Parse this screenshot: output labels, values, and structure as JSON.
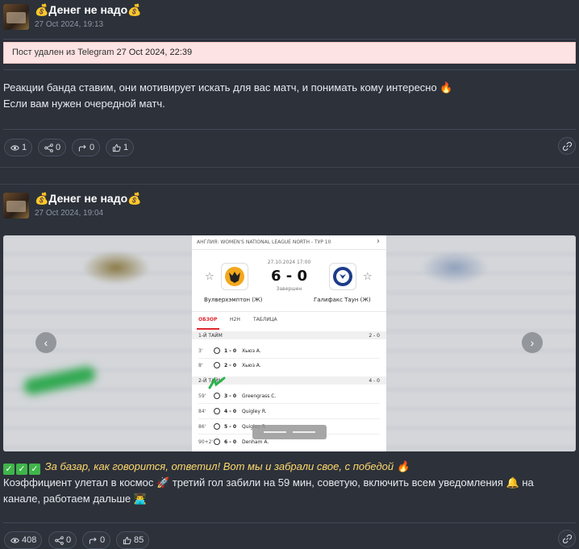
{
  "posts": [
    {
      "channel_name": "💰Денег не надо💰",
      "date": "27 Oct 2024, 19:13",
      "deleted_prefix": "Пост удален из Telegram ",
      "deleted_date": "27 Oct 2024, 22:39",
      "text_line1": "Реакции банда ставим, они мотивирует искать для вас матч, и понимать кому интересно 🔥",
      "text_line2": "Если вам нужен очередной матч.",
      "stats": {
        "views": "1",
        "shares": "0",
        "forwards": "0",
        "reactions": "1"
      }
    },
    {
      "channel_name": "💰Денег не надо💰",
      "date": "27 Oct 2024, 19:04",
      "text_line1_italic": "За базар, как говорится, ответил! Вот мы и забрали свое, с победой 🔥",
      "text_line2": "Коэффициент улетал в космос 🚀 третий гол забили на 59 мин, советую, включить всем уведомления 🔔 на",
      "text_line3": "канале, работаем дальше 👨‍💻",
      "stats": {
        "views": "408",
        "shares": "0",
        "forwards": "0",
        "reactions": "85"
      }
    }
  ],
  "match_card": {
    "league": "АНГЛИЯ: WOMEN'S NATIONAL LEAGUE NORTH - ТУР 10",
    "datetime": "27.10.2024 17:00",
    "score": "6 - 0",
    "status": "Завершен",
    "home_team": "Вулверхэмптон (Ж)",
    "away_team": "Галифакс Таун (Ж)",
    "tabs": [
      "ОБЗОР",
      "H2H",
      "ТАБЛИЦА"
    ],
    "first_half": {
      "label": "1-Й ТАЙМ",
      "score": "2 - 0"
    },
    "second_half": {
      "label": "2-Й ТАЙМ",
      "score": "4 - 0"
    },
    "goals": [
      {
        "minute": "3'",
        "score": "1 - 0",
        "player": "Хьюз А."
      },
      {
        "minute": "8'",
        "score": "2 - 0",
        "player": "Хьюз А."
      },
      {
        "minute": "59'",
        "score": "3 - 0",
        "player": "Greengrass C."
      },
      {
        "minute": "84'",
        "score": "4 - 0",
        "player": "Quigley R."
      },
      {
        "minute": "86'",
        "score": "5 - 0",
        "player": "Quigley R."
      },
      {
        "minute": "90+2'",
        "score": "6 - 0",
        "player": "Denham A."
      }
    ]
  },
  "icons": {
    "views": "eye-icon",
    "shares": "share-icon",
    "forwards": "forward-icon",
    "reactions": "thumbs-up-icon",
    "link": "link-icon"
  },
  "colors": {
    "background": "#2c313a",
    "deleted_banner": "#fde3e3",
    "accent_red": "#e0262d"
  }
}
